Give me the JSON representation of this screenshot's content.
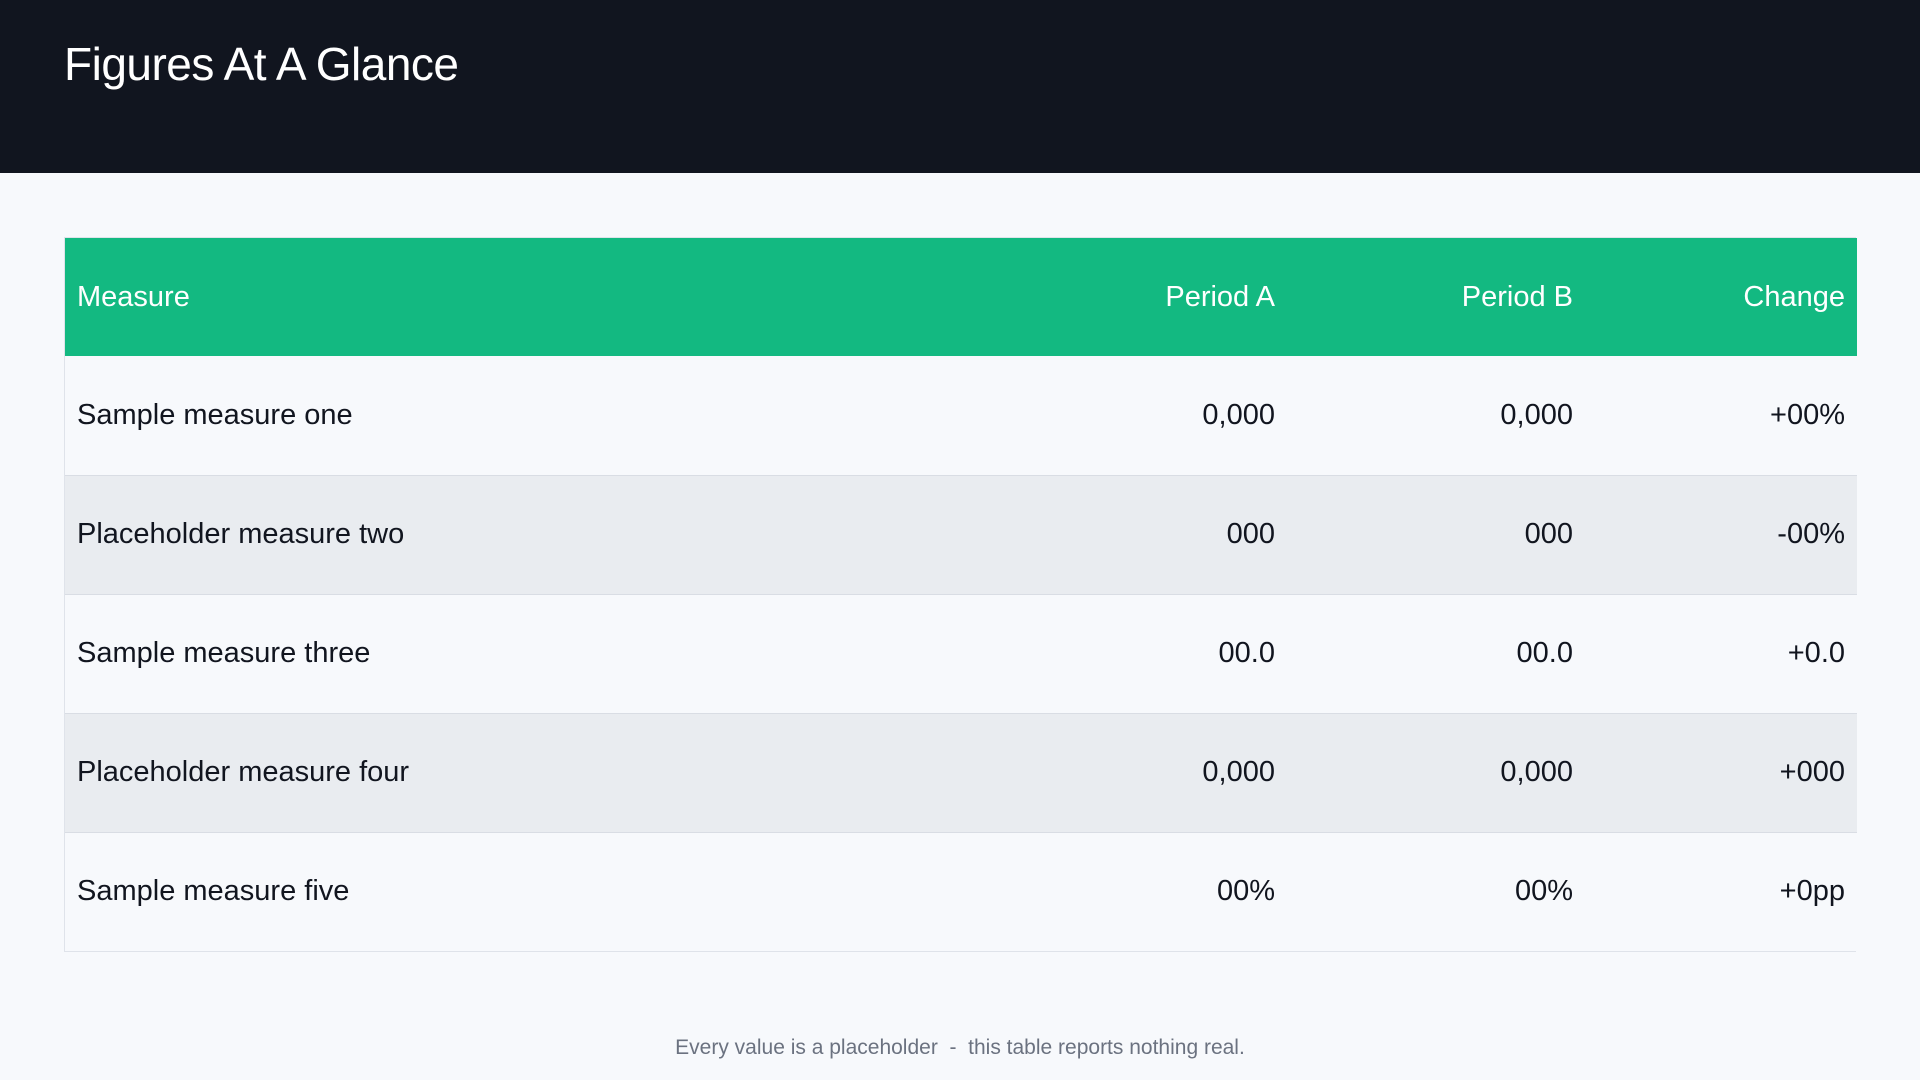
{
  "header": {
    "title": "Figures At A Glance",
    "background_color": "#11151f"
  },
  "table": {
    "header_color": "#13b981",
    "columns": [
      "Measure",
      "Period A",
      "Period B",
      "Change"
    ],
    "rows": [
      [
        "Sample measure one",
        "0,000",
        "0,000",
        "+00%"
      ],
      [
        "Placeholder measure two",
        "000",
        "000",
        "-00%"
      ],
      [
        "Sample measure three",
        "00.0",
        "00.0",
        "+0.0"
      ],
      [
        "Placeholder measure four",
        "0,000",
        "0,000",
        "+000"
      ],
      [
        "Sample measure five",
        "00%",
        "00%",
        "+0pp"
      ]
    ]
  },
  "footer": {
    "note": "Every value is a placeholder  -  this table reports nothing real."
  }
}
